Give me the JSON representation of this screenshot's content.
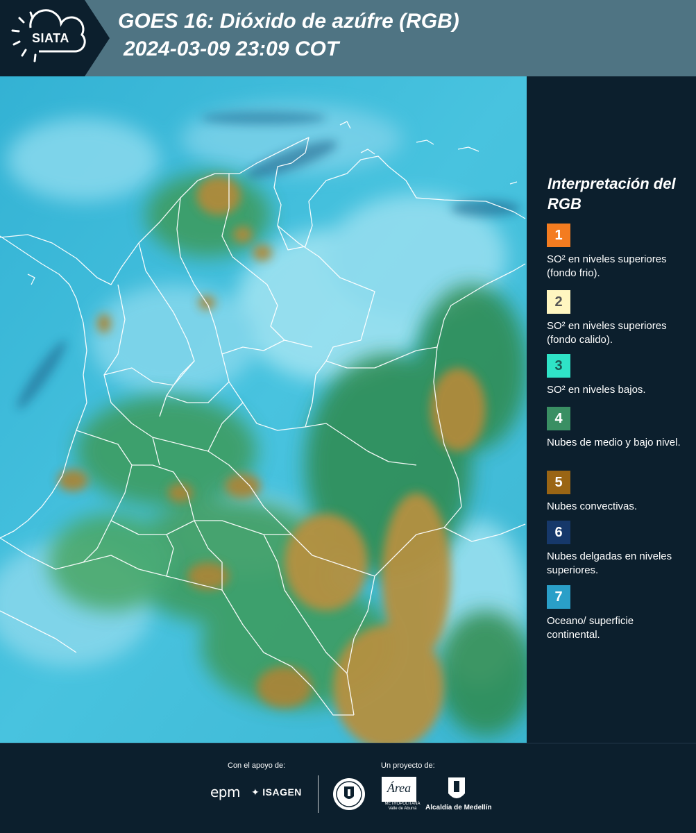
{
  "header": {
    "logo": "SIATA",
    "title_line1": "GOES 16: Dióxido de azúfre (RGB)",
    "title_line2": "2024-03-09 23:09 COT"
  },
  "legend": {
    "title": "Interpretación del RGB",
    "items": [
      {
        "number": "1",
        "label": "SO² en niveles superiores (fondo frio).",
        "color": "#f47c20",
        "text_color": "#ffffff"
      },
      {
        "number": "2",
        "label": "SO² en niveles superiores (fondo calido).",
        "color": "#fff6c0",
        "text_color": "#555555"
      },
      {
        "number": "3",
        "label": "SO² en niveles bajos.",
        "color": "#2fe3c7",
        "text_color": "#1a5a55"
      },
      {
        "number": "4",
        "label": "Nubes de medio y bajo nivel.",
        "color": "#3a8f63",
        "text_color": "#ffffff"
      },
      {
        "number": "5",
        "label": "Nubes convectivas.",
        "color": "#9a6514",
        "text_color": "#ffffff"
      },
      {
        "number": "6",
        "label": "Nubes delgadas en niveles superiores.",
        "color": "#16386a",
        "text_color": "#ffffff"
      },
      {
        "number": "7",
        "label": "Oceano/ superficie continental.",
        "color": "#2a9fc8",
        "text_color": "#ffffff"
      }
    ]
  },
  "footer": {
    "support_label": "Con el apoyo de:",
    "project_label": "Un proyecto de:",
    "sponsor1": "epm",
    "sponsor2": "ISAGEN",
    "partner1": "Área",
    "partner1_sub": "METROPOLITANA Valle de Aburrá",
    "partner2": "Alcaldía de Medellín"
  }
}
